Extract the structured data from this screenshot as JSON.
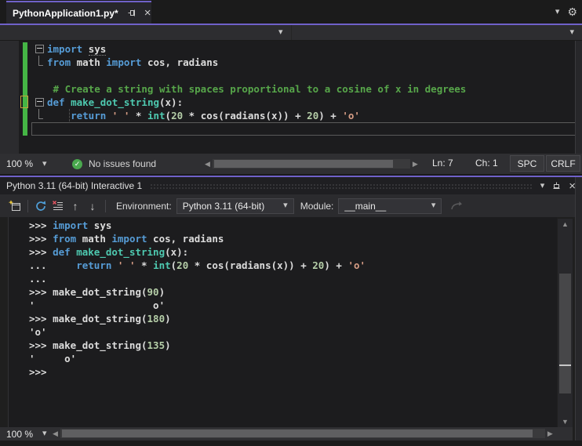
{
  "palette": {
    "accent_purple": "#6f61c9",
    "keyword_blue": "#569cd6",
    "type_teal": "#4ec9b0",
    "string_red": "#d69d85",
    "number_green": "#b5cea8",
    "comment_green": "#57a64a",
    "plain_text": "#dcdcdc",
    "change_bar_green": "#45b545",
    "check_green": "#4aa94e",
    "reset_icon_blue": "#4f9fd8"
  },
  "icons": {
    "close": "×",
    "chevron_down": "▾",
    "gear": "⚙",
    "check": "✓",
    "up_arrow": "↑",
    "down_arrow": "↓",
    "scroll_up": "▲",
    "scroll_down": "▼",
    "scroll_left": "◀",
    "scroll_right": "▶"
  },
  "editor_tab": {
    "title": "PythonApplication1.py*"
  },
  "editor": {
    "lines": [
      {
        "fold": "minus",
        "tokens": [
          [
            "k",
            "import"
          ],
          [
            "p",
            " "
          ],
          [
            "u",
            "sys"
          ]
        ]
      },
      {
        "fold": "line",
        "tokens": [
          [
            "k",
            "from"
          ],
          [
            "p",
            " math "
          ],
          [
            "k",
            "import"
          ],
          [
            "p",
            " cos, radians"
          ]
        ]
      },
      {
        "tokens": []
      },
      {
        "tokens": [
          [
            "c",
            " # Create a string with spaces proportional to a cosine of x in degrees"
          ]
        ]
      },
      {
        "fold": "minus",
        "tokens": [
          [
            "k",
            "def"
          ],
          [
            "p",
            " "
          ],
          [
            "t",
            "make_dot_string"
          ],
          [
            "p",
            "(x):"
          ]
        ]
      },
      {
        "fold": "line",
        "tokens": [
          [
            "p",
            "    "
          ],
          [
            "k",
            "return"
          ],
          [
            "p",
            " "
          ],
          [
            "s",
            "' '"
          ],
          [
            "p",
            " * "
          ],
          [
            "t",
            "int"
          ],
          [
            "p",
            "("
          ],
          [
            "n",
            "20"
          ],
          [
            "p",
            " * cos(radians(x)) + "
          ],
          [
            "n",
            "20"
          ],
          [
            "p",
            ") + "
          ],
          [
            "s",
            "'o'"
          ]
        ]
      },
      {
        "current": true,
        "tokens": []
      }
    ]
  },
  "editor_status": {
    "zoom": "100 %",
    "message": "No issues found",
    "line": "Ln: 7",
    "column": "Ch: 1",
    "spaces": "SPC",
    "line_endings": "CRLF"
  },
  "interactive": {
    "title": "Python 3.11 (64-bit) Interactive 1",
    "toolbar": {
      "environment_label": "Environment:",
      "environment_value": "Python 3.11 (64-bit)",
      "module_label": "Module:",
      "module_value": "__main__"
    },
    "lines": [
      {
        "tokens": [
          [
            "p",
            ">>> "
          ],
          [
            "k",
            "import"
          ],
          [
            "p",
            " sys"
          ]
        ]
      },
      {
        "tokens": [
          [
            "p",
            ">>> "
          ],
          [
            "k",
            "from"
          ],
          [
            "p",
            " math "
          ],
          [
            "k",
            "import"
          ],
          [
            "p",
            " cos, radians"
          ]
        ]
      },
      {
        "tokens": [
          [
            "p",
            ">>> "
          ],
          [
            "k",
            "def"
          ],
          [
            "p",
            " "
          ],
          [
            "t",
            "make_dot_string"
          ],
          [
            "p",
            "(x):"
          ]
        ]
      },
      {
        "tokens": [
          [
            "p",
            "...     "
          ],
          [
            "k",
            "return"
          ],
          [
            "p",
            " "
          ],
          [
            "s",
            "' '"
          ],
          [
            "p",
            " * "
          ],
          [
            "t",
            "int"
          ],
          [
            "p",
            "("
          ],
          [
            "n",
            "20"
          ],
          [
            "p",
            " * cos(radians(x)) + "
          ],
          [
            "n",
            "20"
          ],
          [
            "p",
            ") + "
          ],
          [
            "s",
            "'o'"
          ]
        ]
      },
      {
        "tokens": [
          [
            "p",
            "..."
          ]
        ]
      },
      {
        "tokens": [
          [
            "p",
            ">>> make_dot_string("
          ],
          [
            "n",
            "90"
          ],
          [
            "p",
            ")"
          ]
        ]
      },
      {
        "tokens": [
          [
            "p",
            "'                    o'"
          ]
        ]
      },
      {
        "tokens": [
          [
            "p",
            ">>> make_dot_string("
          ],
          [
            "n",
            "180"
          ],
          [
            "p",
            ")"
          ]
        ]
      },
      {
        "tokens": [
          [
            "p",
            "'o'"
          ]
        ]
      },
      {
        "tokens": [
          [
            "p",
            ">>> make_dot_string("
          ],
          [
            "n",
            "135"
          ],
          [
            "p",
            ")"
          ]
        ]
      },
      {
        "tokens": [
          [
            "p",
            "'     o'"
          ]
        ]
      },
      {
        "tokens": [
          [
            "p",
            ">>> "
          ]
        ]
      }
    ],
    "status_zoom": "100 %"
  }
}
